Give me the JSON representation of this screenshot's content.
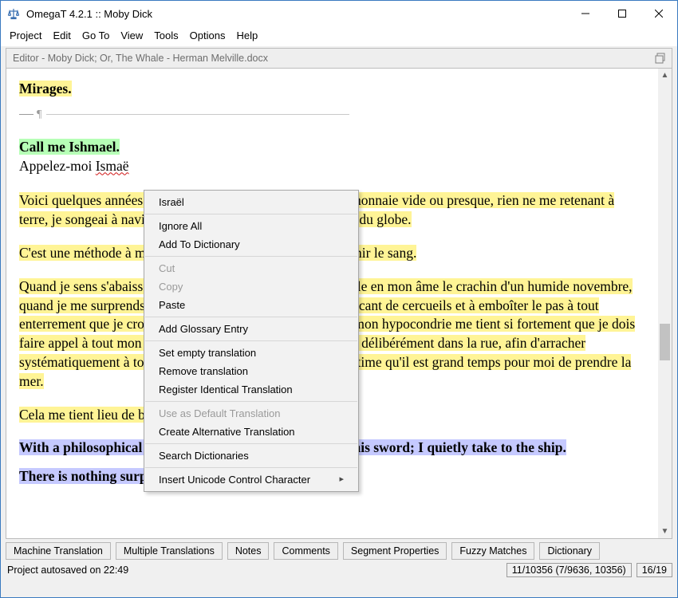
{
  "window": {
    "title": "OmegaT 4.2.1 :: Moby Dick"
  },
  "menubar": [
    "Project",
    "Edit",
    "Go To",
    "View",
    "Tools",
    "Options",
    "Help"
  ],
  "subheader": {
    "text": "Editor - Moby Dick; Or, The Whale - Herman Melville.docx"
  },
  "segments": {
    "s0": "Mirages.",
    "s1_src": "Call me Ishmael.",
    "s1_tr_a": "Appelez-moi ",
    "s1_tr_b": "Ismaë",
    "s2": "Voici quelques années — peu importe combien — le porte-monnaie vide ou presque, rien ne me retenant à terre, je songeai à naviguer un peu et à voir l'étendue liquide du globe.",
    "s3": "C'est une méthode à moi pour secouer la mélancolie et rajeunir le sang.",
    "s4": "Quand je sens s'abaisser le coin de mes lèvres, quand s'installe en mon âme le crachin d'un humide novembre, quand je me surprends à faire halte devant l'échoppe du fabricant de cercueils et à emboîter le pas à tout enterrement que je croise, et, plus particulièrement, lorsque mon hypocondrie me tient si fortement que je dois faire appel à tout mon sens moral pour me retenir de me ruer délibérément dans la rue, afin d'arracher systématiquement à tout un chacun son chapeau… alors, j'estime qu'il est grand temps pour moi de prendre la mer.",
    "s5": "Cela me tient lieu de balle et de pistolet.",
    "s6": "With a philosophical flourish Cato throws himself upon his sword; I quietly take to the ship.",
    "s7": "There is nothing surprising in this."
  },
  "context_menu": {
    "items": [
      {
        "label": "Israël",
        "enabled": true
      },
      {
        "sep": true
      },
      {
        "label": "Ignore All",
        "enabled": true
      },
      {
        "label": "Add To Dictionary",
        "enabled": true
      },
      {
        "sep": true
      },
      {
        "label": "Cut",
        "enabled": false
      },
      {
        "label": "Copy",
        "enabled": false
      },
      {
        "label": "Paste",
        "enabled": true
      },
      {
        "sep": true
      },
      {
        "label": "Add Glossary Entry",
        "enabled": true
      },
      {
        "sep": true
      },
      {
        "label": "Set empty translation",
        "enabled": true
      },
      {
        "label": "Remove translation",
        "enabled": true
      },
      {
        "label": "Register Identical Translation",
        "enabled": true
      },
      {
        "sep": true
      },
      {
        "label": "Use as Default Translation",
        "enabled": false
      },
      {
        "label": "Create Alternative Translation",
        "enabled": true
      },
      {
        "sep": true
      },
      {
        "label": "Search Dictionaries",
        "enabled": true
      },
      {
        "sep": true
      },
      {
        "label": "Insert Unicode Control Character",
        "enabled": true,
        "submenu": true
      }
    ]
  },
  "tabs": [
    "Machine Translation",
    "Multiple Translations",
    "Notes",
    "Comments",
    "Segment Properties",
    "Fuzzy Matches",
    "Dictionary"
  ],
  "status": {
    "message": "Project autosaved on 22:49",
    "counts": "11/10356 (7/9636, 10356)",
    "pos": "16/19"
  }
}
